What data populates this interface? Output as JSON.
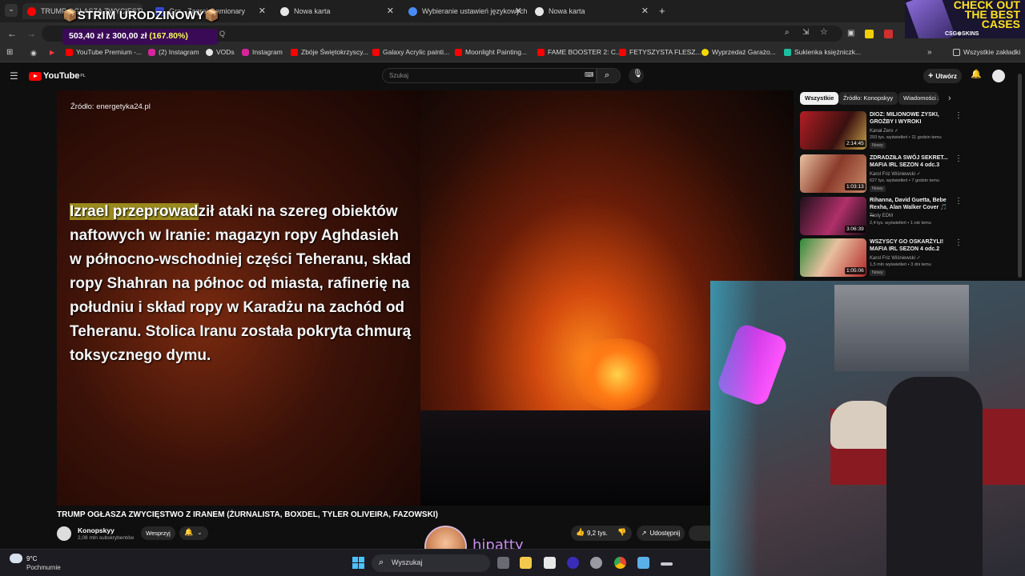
{
  "browser": {
    "tabs": [
      {
        "label": "TRUMP OGŁASZA ZWYCIĘSTWO Z IRANEM",
        "active": true
      },
      {
        "label": "Gra - Zagraj Gamionary"
      },
      {
        "label": "Nowa karta"
      },
      {
        "label": "Wybieranie ustawień językowych"
      },
      {
        "label": "Nowa karta"
      }
    ],
    "url": "Q",
    "bookmarks": [
      "YouTube Premium -...",
      "(2) Instagram",
      "VODs",
      "Instagram",
      "Zbóje Świętokrzyscy...",
      "Galaxy Acrylic painti...",
      "Moonlight Painting...",
      "FAME BOOSTER 2: C...",
      "FETYSZYSTA FLESZ...",
      "Wyprzedaż Garażo...",
      "Sukienka księżniczk..."
    ],
    "all_bookmarks": "Wszystkie zakładki"
  },
  "overlay": {
    "stream_title": "📦STRIM URODZINOWY📦",
    "donation_text": "503,40 zł z 300,00 zł",
    "donation_pct": "(167.80%)",
    "ad_headline": "CHECK OUT THE BEST CASES",
    "ad_brand": "CSG⊕SKINS",
    "streamer_name": "hipatty"
  },
  "youtube": {
    "logo": "YouTube",
    "logo_region": "PL",
    "search_placeholder": "Szukaj",
    "create_label": "Utwórz",
    "video": {
      "source": "Źródło: energetyka24.pl",
      "caption_highlight": "Izrael przeprowad",
      "caption_rest": "ził ataki na szereg obiektów naftowych w Iranie: magazyn ropy Aghdasieh w północno-wschodniej części Teheranu, skład ropy Shahran na północ od miasta, rafinerię na południu i skład ropy w Karadżu na zachód od Teheranu. Stolica Iranu została pokryta chmurą toksycznego dymu.",
      "title": "TRUMP OGŁASZA ZWYCIĘSTWO Z IRANEM (ŻURNALISTA, BOXDEL, TYLER OLIVEIRA, FAZOWSKI)",
      "channel": "Konopskyy",
      "subscribers": "2,08 mln subskrybentów",
      "support_label": "Wesprzyj",
      "likes": "9,2 tys.",
      "share_label": "Udostępnij"
    },
    "chips": [
      "Wszystkie",
      "Źródło: Konopskyy",
      "Wiadomości z"
    ],
    "recommendations": [
      {
        "title": "DIOZ: MILIONOWE ZYSKI, GROŹBY I WYROKI",
        "channel": "Kanał Zero ✓",
        "meta": "293 tys. wyświetleń • 11 godzin temu",
        "badge": "Nowy",
        "duration": "2:14:45"
      },
      {
        "title": "ZDRADZIŁA SWÓJ SEKRET... MAFIA IRL SEZON 4 odc.3",
        "channel": "Karol Friz Wiśniewski ✓",
        "meta": "627 tys. wyświetleń • 7 godzin temu",
        "badge": "Nowy",
        "duration": "1:03:13"
      },
      {
        "title": "Rihanna, David Guetta, Bebe Rexha, Alan Walker Cover 🎵 ...",
        "channel": "Tasty EDM",
        "meta": "2,4 tys. wyświetleń • 1 rok temu",
        "badge": "",
        "duration": "3:06:39"
      },
      {
        "title": "WSZYSCY GO OSKARŻYLI! MAFIA IRL SEZON 4 odc.2",
        "channel": "Karol Friz Wiśniewski ✓",
        "meta": "1,5 mln wyświetleń • 3 dni temu",
        "badge": "Nowy",
        "duration": "1:05:06"
      }
    ]
  },
  "taskbar": {
    "temperature": "9°C",
    "weather": "Pochmurnie",
    "search_label": "Wyszukaj"
  }
}
